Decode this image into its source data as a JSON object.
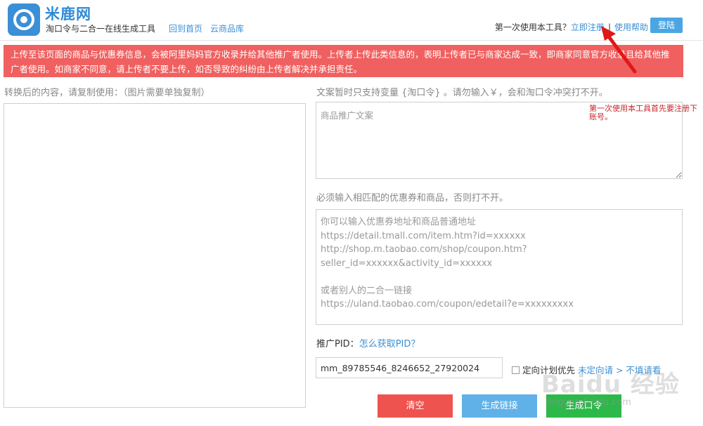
{
  "header": {
    "brand": "米鹿网",
    "tagline": "淘口令与二合一在线生成工具",
    "nav_home": "回到首页",
    "nav_library": "云商品库",
    "first_time": "第一次使用本工具？",
    "register": "立即注册",
    "separator": "|",
    "help": "使用帮助",
    "login": "登陆"
  },
  "notice": {
    "text": "上传至该页面的商品与优惠券信息，会被阿里妈妈官方收录并给其他推广者使用。上传者上传此类信息的，表明上传者已与商家达成一致，即商家同意官方收录且给其他推广者使用。如商家不同意，请上传者不要上传，如否导致的纠纷由上传者解决并承担责任。"
  },
  "left": {
    "label": "转换后的内容，请复制使用：（图片需要单独复制）",
    "output": ""
  },
  "right": {
    "copy_label": "文案暂时只支持变量 {淘口令} 。请勿输入￥，会和淘口令冲突打不开。",
    "copy_placeholder": "商品推广文案",
    "link_label": "必须输入相匹配的优惠券和商品，否则打不开。",
    "link_placeholder": {
      "line1": "你可以输入优惠券地址和商品普通地址",
      "line2": "https://detail.tmall.com/item.htm?id=xxxxxx",
      "line3": "http://shop.m.taobao.com/shop/coupon.htm?",
      "line4": "seller_id=xxxxxx&activity_id=xxxxxx",
      "line5": "或者别人的二合一链接",
      "line6": "https://uland.taobao.com/coupon/edetail?e=xxxxxxxxx"
    },
    "pid_label": "推广PID：",
    "pid_help": "怎么获取PID？",
    "pid_value": "mm_89785546_8246652_27920024",
    "targeted_label": "定向计划优先",
    "targeted_link": "未定向请 > 不填请看"
  },
  "buttons": {
    "clear": "清空",
    "gen_link": "生成链接",
    "gen_both": "生成口令"
  },
  "annotation": {
    "text": "第一次使用本工具首先要注册下账号。"
  },
  "watermark": {
    "logo": "Baidu 经验",
    "url": "jingyan.baidu.com"
  },
  "colors": {
    "brand": "#2f8ad6",
    "link": "#3a8fd6",
    "notice_bg": "#f06060",
    "login_btn": "#4aa6e3",
    "clear_btn": "#ef5350",
    "link_btn": "#5fb1e8",
    "both_btn": "#2db84a",
    "annotation": "#c8262b"
  },
  "icons": {
    "logo": "camera-lens-logo-icon",
    "annotation_arrow": "red-arrow-icon"
  }
}
